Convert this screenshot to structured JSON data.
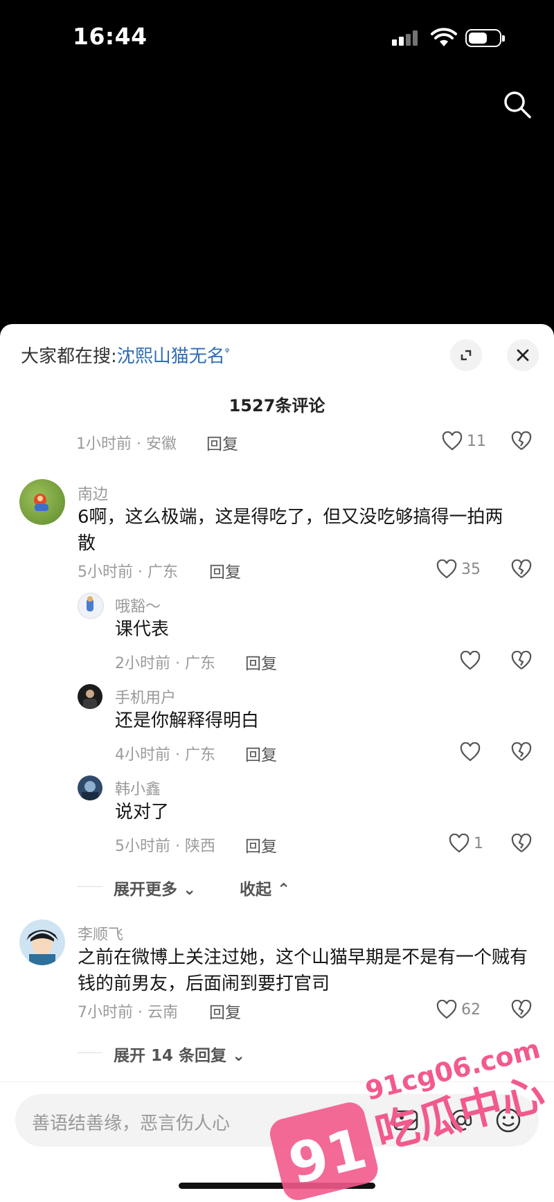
{
  "status_bar": {
    "time": "16:44"
  },
  "sheet": {
    "hot_search_label": "大家都在搜:",
    "hot_search_term": "沈熙山猫无名",
    "comment_count": "1527条评论"
  },
  "top_partial": {
    "time_loc": "1小时前 · 安徽",
    "reply": "回复",
    "likes": "11"
  },
  "comments": [
    {
      "name": "南边",
      "text": "6啊，这么极端，这是得吃了，但又没吃够搞得一拍两散",
      "time_loc": "5小时前 · 广东",
      "reply": "回复",
      "likes": "35",
      "replies": [
        {
          "name": "哦豁～",
          "text": "课代表",
          "time_loc": "2小时前 · 广东",
          "reply": "回复",
          "likes": ""
        },
        {
          "name": "手机用户",
          "text": "还是你解释得明白",
          "time_loc": "4小时前 · 广东",
          "reply": "回复",
          "likes": ""
        },
        {
          "name": "韩小鑫",
          "text": "说对了",
          "time_loc": "5小时前 · 陕西",
          "reply": "回复",
          "likes": "1"
        }
      ],
      "expand_more": "展开更多",
      "collapse": "收起"
    },
    {
      "name": "李顺飞",
      "text": "之前在微博上关注过她，这个山猫早期是不是有一个贼有钱的前男友，后面闹到要打官司",
      "time_loc": "7小时前 · 云南",
      "reply": "回复",
      "likes": "62",
      "expand_replies": "展开 14 条回复"
    }
  ],
  "input": {
    "placeholder": "善语结善缘，恶言伤人心"
  },
  "watermark": {
    "url": "91cg06.com",
    "number": "91",
    "brand": "吃瓜中心",
    "color": "#f25a8c"
  },
  "icons": [
    "search-icon",
    "fullscreen-icon",
    "close-icon",
    "heart-icon",
    "broken-heart-icon",
    "image-icon",
    "at-icon",
    "emoji-icon"
  ]
}
